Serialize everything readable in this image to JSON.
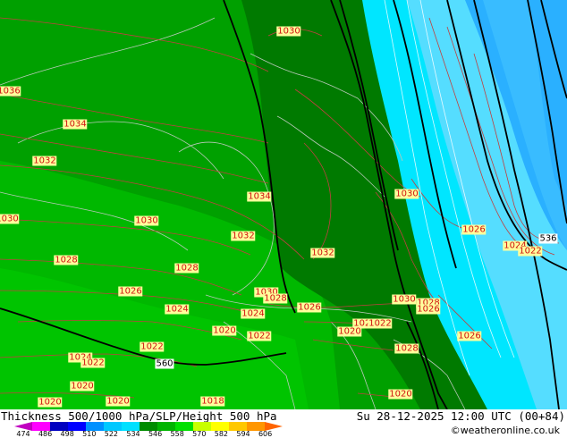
{
  "map": {
    "colors": {
      "c546": "#00a000",
      "c552": "#008c00",
      "c558": "#007800",
      "c540": "#00b800",
      "c534": "#00c800",
      "c528": "#00e0ff",
      "c522": "#44ccff",
      "c516": "#30aaff"
    },
    "pressure_labels": [
      {
        "text": "1036"
      },
      {
        "text": "1034"
      },
      {
        "text": "1032"
      },
      {
        "text": "1030"
      },
      {
        "text": "1030"
      },
      {
        "text": "1028"
      },
      {
        "text": "1028"
      },
      {
        "text": "1026"
      },
      {
        "text": "1024"
      },
      {
        "text": "1024"
      },
      {
        "text": "1022"
      },
      {
        "text": "1022"
      },
      {
        "text": "1020"
      },
      {
        "text": "1020"
      },
      {
        "text": "1018"
      },
      {
        "text": "1020"
      },
      {
        "text": "1030"
      },
      {
        "text": "1034"
      },
      {
        "text": "1032"
      },
      {
        "text": "1032"
      },
      {
        "text": "1030"
      },
      {
        "text": "1028"
      },
      {
        "text": "1026"
      },
      {
        "text": "1024"
      },
      {
        "text": "1022"
      },
      {
        "text": "1020"
      },
      {
        "text": "1024"
      },
      {
        "text": "1020"
      },
      {
        "text": "1022"
      },
      {
        "text": "1030"
      },
      {
        "text": "1028"
      },
      {
        "text": "1026"
      },
      {
        "text": "1030"
      },
      {
        "text": "1026"
      },
      {
        "text": "1026"
      },
      {
        "text": "1028"
      },
      {
        "text": "1024"
      },
      {
        "text": "1022"
      },
      {
        "text": "1026"
      },
      {
        "text": "1020"
      },
      {
        "text": "1030"
      },
      {
        "text": "1034"
      },
      {
        "text": "1032"
      }
    ],
    "thickness_labels": [
      {
        "text": "560"
      },
      {
        "text": "536"
      }
    ]
  },
  "footer": {
    "title": "Thickness 500/1000 hPa/SLP/Height 500 hPa",
    "datetime": "Su 28-12-2025 12:00 UTC (00+84)",
    "credit": "©weatheronline.co.uk",
    "scale": {
      "ticks": [
        "474",
        "486",
        "498",
        "510",
        "522",
        "534",
        "546",
        "558",
        "570",
        "582",
        "594",
        "606"
      ],
      "colors": [
        "#c000c0",
        "#ff00ff",
        "#0000c0",
        "#0000ff",
        "#0090ff",
        "#00c8ff",
        "#00e0ff",
        "#008c00",
        "#00b400",
        "#00e000",
        "#c8ff00",
        "#ffff00",
        "#ffc800",
        "#ff9600",
        "#ff6400"
      ]
    }
  }
}
